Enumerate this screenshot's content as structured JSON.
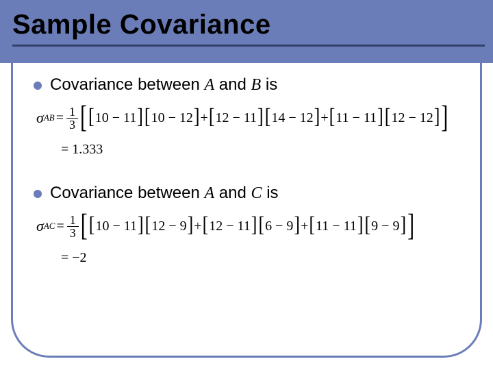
{
  "title": "Sample Covariance",
  "bullets": [
    {
      "pre": "Covariance between ",
      "varA": "A",
      "mid": " and ",
      "varB": "B",
      "post": " is"
    },
    {
      "pre": "Covariance between ",
      "varA": "A",
      "mid": " and ",
      "varB": "C",
      "post": " is"
    }
  ],
  "formulas": {
    "ab": {
      "sigma_sub": "AB",
      "frac_num": "1",
      "frac_den": "3",
      "t1a": "10 − 11",
      "t1b": "10 − 12",
      "t2a": "12 − 11",
      "t2b": "14 − 12",
      "t3a": "11 − 11",
      "t3b": "12 − 12",
      "result": "= 1.333"
    },
    "ac": {
      "sigma_sub": "AC",
      "frac_num": "1",
      "frac_den": "3",
      "t1a": "10 − 11",
      "t1b": "12 − 9",
      "t2a": "12 − 11",
      "t2b": "6 − 9",
      "t3a": "11 − 11",
      "t3b": "9 − 9",
      "result": "= −2"
    }
  }
}
